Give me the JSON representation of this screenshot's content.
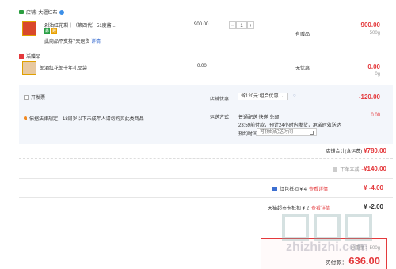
{
  "store": {
    "name": "店铺: 大疆红布",
    "icon": "store-icon"
  },
  "item1": {
    "title": "剁油红花剩十（第四代）51度酱...",
    "tags": [
      "券",
      "赠"
    ],
    "note": "此商品不支持7天退货",
    "note_link": "详情",
    "unit_price": "900.00",
    "qty": "1",
    "discount_label": "有赠品",
    "total": "900.00",
    "weight": "500g"
  },
  "gift": {
    "section_label": "活赠品",
    "title": "郎酒红花郎十年礼品袋",
    "price": "0.00",
    "label": "无优惠",
    "total": "0.00",
    "weight": "0g"
  },
  "options": {
    "invoice": "开发票",
    "notice": "依据法律规定，18周岁以下未成年人请勿购买此类商品",
    "coupon_label": "店铺优惠：",
    "coupon_value": "省120元:组合优惠",
    "coupon_amount": "-120.00",
    "ship_label": "运送方式：",
    "ship_value": "普通配送 快递 免邮",
    "ship_note": "23:59前付款，预计24小时内发货，承诺时效送达",
    "ship_amount": "0.00",
    "appoint_label": "预约时间",
    "appoint_value": "可预约配送时间"
  },
  "store_total": {
    "label": "店铺合计(含运费)",
    "value": "¥780.00"
  },
  "summary": {
    "line1_label": "下单立减",
    "line1_value": "-¥140.00",
    "line2_label": "红包抵扣 ¥ 4",
    "line2_link": "查看详情",
    "line2_value": "¥ -4.00",
    "line3_label": "天猫超市卡抵扣 ¥ 2",
    "line3_link": "查看详情",
    "line3_value": "¥ -2.00"
  },
  "final": {
    "weight_label": "总重量：",
    "weight": "500g",
    "pay_label": "实付款：",
    "pay_value": "636.00"
  },
  "watermark": "zhizhizhi.com",
  "colors": {
    "accent": "#e4393c",
    "link": "#3c6fd1"
  }
}
